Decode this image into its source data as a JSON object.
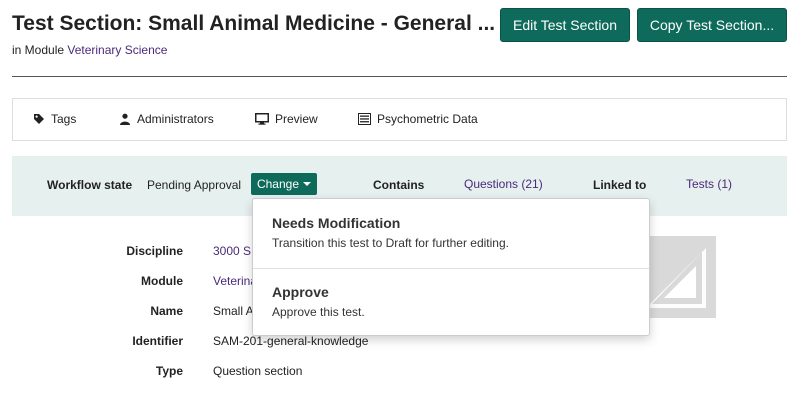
{
  "header": {
    "title": "Test Section: Small Animal Medicine - General ...",
    "module_prefix": "in Module",
    "module_link": "Veterinary Science",
    "edit_button": "Edit Test Section",
    "copy_button": "Copy Test Section..."
  },
  "tabs": [
    {
      "label": "Tags",
      "icon": "tag-icon"
    },
    {
      "label": "Administrators",
      "icon": "user-icon"
    },
    {
      "label": "Preview",
      "icon": "monitor-icon"
    },
    {
      "label": "Psychometric Data",
      "icon": "list-icon"
    }
  ],
  "workflow": {
    "label": "Workflow state",
    "state": "Pending Approval",
    "change_button": "Change",
    "contains_label": "Contains",
    "contains_link": "Questions (21)",
    "linked_label": "Linked to",
    "linked_link": "Tests (1)"
  },
  "dropdown": {
    "items": [
      {
        "title": "Needs Modification",
        "description": "Transition this test to Draft for further editing."
      },
      {
        "title": "Approve",
        "description": "Approve this test."
      }
    ]
  },
  "details": [
    {
      "label": "Discipline",
      "value": "3000 S"
    },
    {
      "label": "Module",
      "value": "Veterina"
    },
    {
      "label": "Name",
      "value": "Small A"
    },
    {
      "label": "Identifier",
      "value": "SAM-201-general-knowledge"
    },
    {
      "label": "Type",
      "value": "Question section"
    }
  ],
  "colors": {
    "primary": "#0e6a5a",
    "link": "#4a2a7a",
    "workflow_bg": "#e6f0ef"
  }
}
